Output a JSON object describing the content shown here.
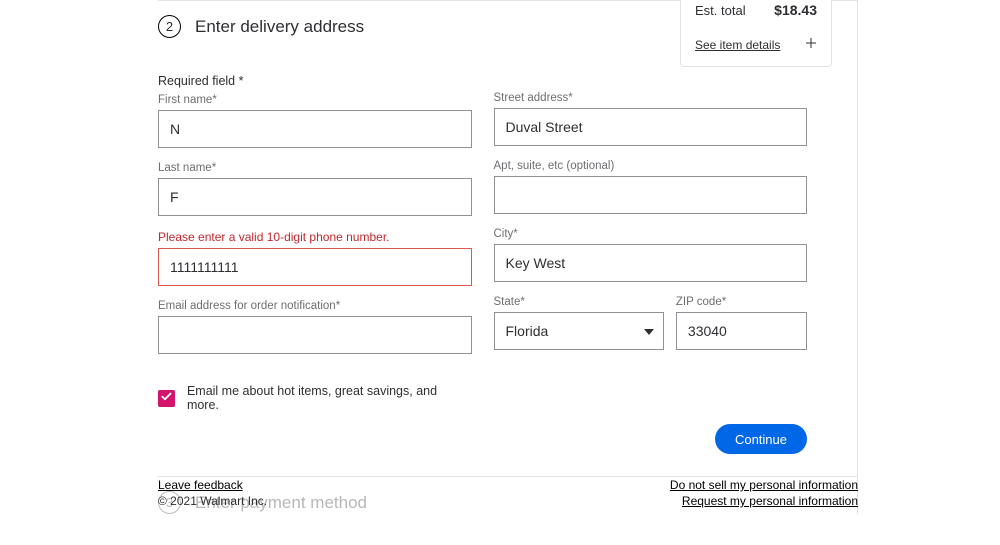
{
  "step2": {
    "number": "2",
    "title": "Enter delivery address",
    "required_note": "Required field *",
    "first_name_label": "First name*",
    "first_name_value": "N",
    "last_name_label": "Last name*",
    "last_name_value": "F",
    "phone_error": "Please enter a valid 10-digit phone number.",
    "phone_value": "1111111111",
    "email_label": "Email address for order notification*",
    "email_value": "",
    "street_label": "Street address*",
    "street_value": "Duval Street",
    "apt_label": "Apt, suite, etc (optional)",
    "apt_value": "",
    "city_label": "City*",
    "city_value": "Key West",
    "state_label": "State*",
    "state_value": "Florida",
    "zip_label": "ZIP code*",
    "zip_value": "33040",
    "marketing_label": "Email me about hot items, great savings, and more.",
    "continue_label": "Continue"
  },
  "step3": {
    "number": "3",
    "title": "Enter payment method"
  },
  "summary": {
    "est_total_label": "Est. total",
    "est_total_value": "$18.43",
    "details_link": "See item details"
  },
  "footer": {
    "leave_feedback": "Leave feedback",
    "copyright": "© 2021 Walmart Inc.",
    "do_not_sell": "Do not sell my personal information",
    "request_info": "Request my personal information"
  }
}
